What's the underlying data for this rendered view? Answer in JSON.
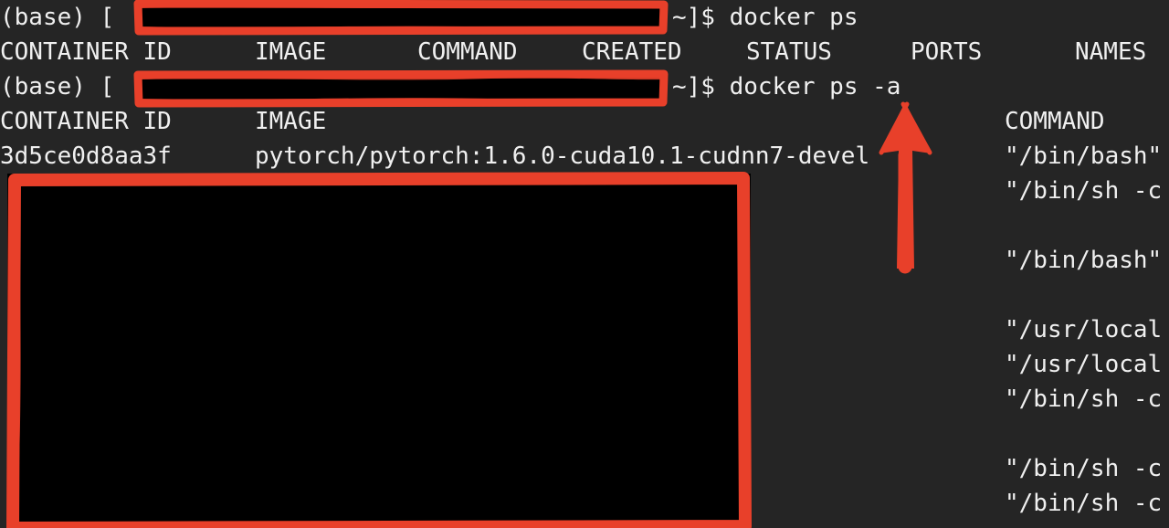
{
  "terminal": {
    "background_color": "#252525",
    "text_color": "#f0f0f0",
    "annotation_color": "#e8402a",
    "lines": {
      "prompt_1_prefix": "(base) [",
      "prompt_1_suffix": "~]$ docker ps",
      "prompt_2_prefix": "(base) [",
      "prompt_2_suffix": "~]$ docker ps -a"
    },
    "headers_1": {
      "container_id": "CONTAINER ID",
      "image": "IMAGE",
      "command": "COMMAND",
      "created": "CREATED",
      "status": "STATUS",
      "ports": "PORTS",
      "names": "NAMES"
    },
    "headers_2": {
      "container_id": "CONTAINER ID",
      "image": "IMAGE",
      "command": "COMMAND"
    },
    "row_1": {
      "container_id": "3d5ce0d8aa3f",
      "image": "pytorch/pytorch:1.6.0-cuda10.1-cudnn7-devel"
    },
    "command_column": [
      "\"/bin/bash\"",
      "\"/bin/sh -c",
      "",
      "\"/bin/bash\"",
      "",
      "\"/usr/local",
      "\"/usr/local",
      "\"/bin/sh -c",
      "",
      "\"/bin/sh -c",
      "\"/bin/sh -c"
    ]
  },
  "annotations": {
    "redaction_bar_1": "hostname-redacted",
    "redaction_bar_2": "hostname-redacted",
    "redaction_box": "output-redacted",
    "arrow": "points-up-at-docker-ps-a-command"
  }
}
